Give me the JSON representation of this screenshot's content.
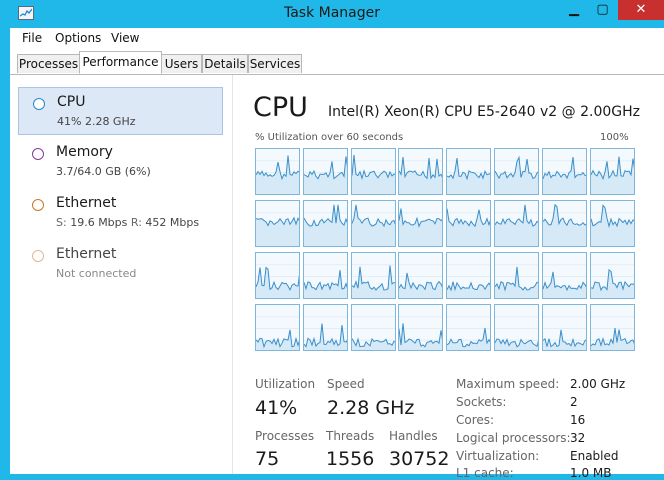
{
  "window": {
    "title": "Task Manager",
    "buttons": {
      "minimize": "▁",
      "maximize": "▢",
      "close": "✕"
    }
  },
  "menu": [
    "File",
    "Options",
    "View"
  ],
  "tabs": [
    {
      "label": "Processes",
      "active": false
    },
    {
      "label": "Performance",
      "active": true
    },
    {
      "label": "Users",
      "active": false
    },
    {
      "label": "Details",
      "active": false
    },
    {
      "label": "Services",
      "active": false
    }
  ],
  "sidebar": [
    {
      "name": "CPU",
      "sub": "41% 2.28 GHz",
      "color": "#2a86c8",
      "selected": true
    },
    {
      "name": "Memory",
      "sub": "3.7/64.0 GB (6%)",
      "color": "#8b3a9a"
    },
    {
      "name": "Ethernet",
      "sub_parts": [
        "S:",
        "19.6 Mbps",
        "R:",
        "452 Mbps"
      ],
      "color": "#c8782a"
    },
    {
      "name": "Ethernet",
      "sub": "Not connected",
      "color": "#e0b890",
      "disabled": true
    }
  ],
  "cpu": {
    "title": "CPU",
    "model": "Intel(R) Xeon(R) CPU E5-2640 v2 @ 2.00GHz",
    "graph_label": "% Utilization over 60 seconds",
    "graph_max": "100%",
    "core_graphs": {
      "count": 32,
      "columns": 8,
      "line_color": "#3a8fca",
      "fill_color": "#d6e9f6"
    },
    "stats": {
      "utilization_label": "Utilization",
      "utilization_value": "41%",
      "speed_label": "Speed",
      "speed_value": "2.28 GHz",
      "processes_label": "Processes",
      "processes_value": "75",
      "threads_label": "Threads",
      "threads_value": "1556",
      "handles_label": "Handles",
      "handles_value": "30752"
    },
    "properties": [
      {
        "label": "Maximum speed:",
        "value": "2.00 GHz"
      },
      {
        "label": "Sockets:",
        "value": "2"
      },
      {
        "label": "Cores:",
        "value": "16"
      },
      {
        "label": "Logical processors:",
        "value": "32"
      },
      {
        "label": "Virtualization:",
        "value": "Enabled"
      },
      {
        "label": "L1 cache:",
        "value": "1.0 MB"
      }
    ]
  }
}
